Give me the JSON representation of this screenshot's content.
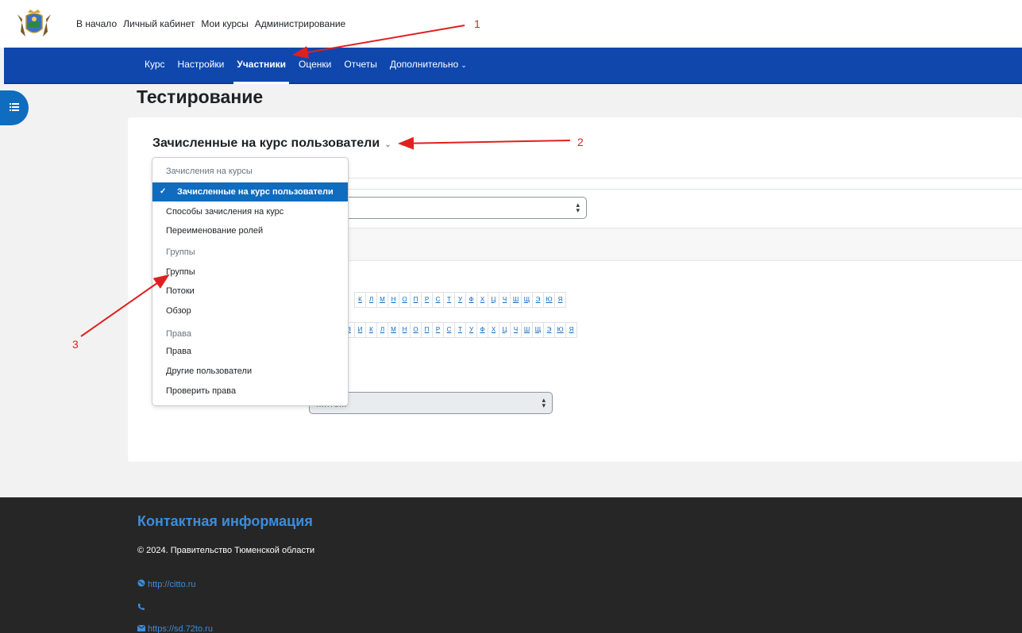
{
  "top_nav": {
    "items": [
      "В начало",
      "Личный кабинет",
      "Мои курсы",
      "Администрирование"
    ]
  },
  "secondary_nav": {
    "items": [
      "Курс",
      "Настройки",
      "Участники",
      "Оценки",
      "Отчеты",
      "Дополнительно"
    ],
    "active": "Участники"
  },
  "page": {
    "title": "Тестирование",
    "heading": "Зачисленные на курс пользователи"
  },
  "menu": {
    "groups": [
      {
        "header": "Зачисления на курсы",
        "items": [
          "Зачисленные на курс пользователи",
          "Способы зачисления на курс",
          "Переименование ролей"
        ]
      },
      {
        "header": "Группы",
        "items": [
          "Группы",
          "Потоки",
          "Обзор"
        ]
      },
      {
        "header": "Права",
        "items": [
          "Права",
          "Другие пользователи",
          "Проверить права"
        ]
      }
    ],
    "selected": "Зачисленные на курс пользователи"
  },
  "filter_select": {
    "placeholder": "...ите..."
  },
  "alphabet_first": [
    "К",
    "Л",
    "М",
    "Н",
    "О",
    "П",
    "Р",
    "С",
    "Т",
    "У",
    "Ф",
    "Х",
    "Ц",
    "Ч",
    "Ш",
    "Щ",
    "Э",
    "Ю",
    "Я"
  ],
  "alphabet_last": [
    "З",
    "И",
    "К",
    "Л",
    "М",
    "Н",
    "О",
    "П",
    "Р",
    "С",
    "Т",
    "У",
    "Ф",
    "Х",
    "Ц",
    "Ч",
    "Ш",
    "Щ",
    "Э",
    "Ю",
    "Я"
  ],
  "annotations": {
    "one": "1",
    "two": "2",
    "three": "3",
    "color": "#e02020"
  },
  "footer": {
    "title": "Контактная информация",
    "copyright": "© 2024. Правительство Тюменской области",
    "link_site": "http://citto.ru",
    "link_email": "https://sd.72to.ru"
  },
  "colors": {
    "nav_blue": "#0f47ad",
    "primary": "#0f6cbf",
    "footer_bg": "#262626",
    "footer_accent": "#3c8ddc"
  },
  "icons": [
    "coat-of-arms-logo",
    "list-icon",
    "globe-icon",
    "phone-icon",
    "envelope-icon"
  ]
}
